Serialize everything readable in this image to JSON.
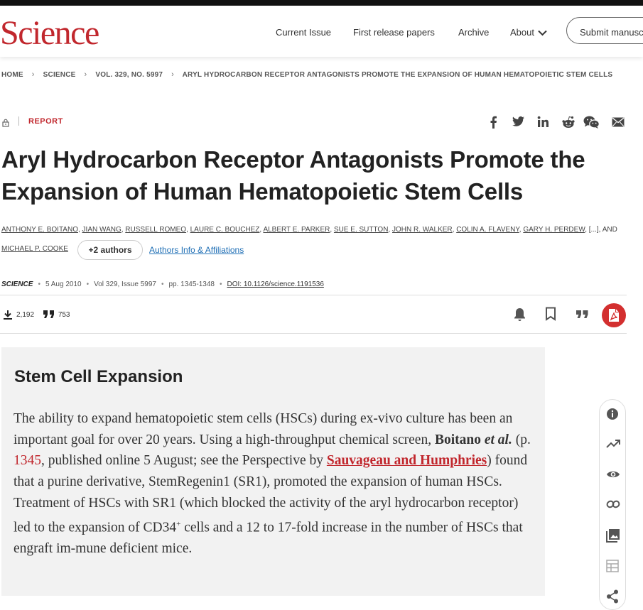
{
  "brand": {
    "logo": "Science",
    "accent_color": "#c1272d"
  },
  "nav": {
    "items": [
      "Current Issue",
      "First release papers",
      "Archive",
      "About"
    ],
    "submit_label": "Submit manuscript"
  },
  "breadcrumb": [
    "HOME",
    "SCIENCE",
    "VOL. 329, NO. 5997",
    "ARYL HYDROCARBON RECEPTOR ANTAGONISTS PROMOTE THE EXPANSION OF HUMAN HEMATOPOIETIC STEM CELLS"
  ],
  "article": {
    "type": "REPORT",
    "title": "Aryl Hydrocarbon Receptor Antagonists Promote the Expansion of Human Hematopoietic Stem Cells",
    "authors_line1": [
      "ANTHONY E. BOITANO",
      "JIAN WANG",
      "RUSSELL ROMEO",
      "LAURE C. BOUCHEZ",
      "ALBERT E. PARKER",
      "SUE E. SUTTON",
      "JOHN R. WALKER",
      "COLIN A. FLAVENY",
      "GARY H. PERDEW"
    ],
    "authors_ellipsis": "[...]",
    "authors_and": "AND",
    "last_author": "MICHAEL P. COOKE",
    "more_authors_label": "+2 authors",
    "affiliations_label": "Authors Info & Affiliations",
    "journal": "SCIENCE",
    "date": "5 Aug 2010",
    "volume": "Vol 329, Issue 5997",
    "pages": "pp. 1345-1348",
    "doi": "DOI: 10.1126/science.1191536"
  },
  "metrics": {
    "downloads": "2,192",
    "citations": "753"
  },
  "share_icons": [
    "facebook-icon",
    "twitter-icon",
    "linkedin-icon",
    "reddit-icon",
    "wechat-icon",
    "email-icon"
  ],
  "article_tools": [
    "bell-icon",
    "bookmark-icon",
    "cite-icon",
    "pdf-icon"
  ],
  "abstract": {
    "heading": "Stem Cell Expansion",
    "p1": "The ability to expand hematopoietic stem cells (HSCs) during ex-vivo culture has been an important goal for over 20 years. Using a high-throughput chemical screen, ",
    "author_ref": "Boitano ",
    "etal": "et al.",
    "p2": " (p. ",
    "page_link": "1345",
    "p3": ", published online 5 August; see the Perspective by ",
    "perspective_link": "Sauvageau and Humphries",
    "p4": ") found that a purine derivative, StemRegenin1 (SR1), promoted the expansion of human HSCs. Treatment of HSCs with SR1 (which blocked the activity of the aryl hydrocarbon receptor) led to the expansion of CD34",
    "sup": "+",
    "p5": " cells and a 12 to 17-fold increase in the number of HSCs that engraft im-mune deficient mice."
  },
  "side_tools": [
    "info-icon",
    "trending-icon",
    "eye-icon",
    "link-icon",
    "image-icon",
    "table-icon",
    "share-icon"
  ]
}
